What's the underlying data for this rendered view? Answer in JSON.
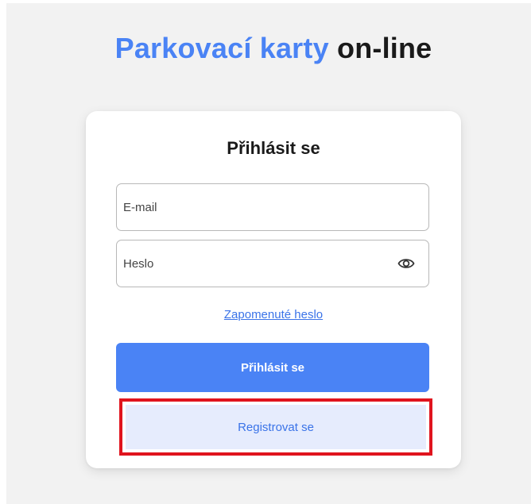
{
  "header": {
    "title_accent": "Parkovací karty",
    "title_rest": "on-line",
    "accent_color": "#4a83f5"
  },
  "login_form": {
    "title": "Přihlásit se",
    "email": {
      "placeholder": "E-mail",
      "value": ""
    },
    "password": {
      "placeholder": "Heslo",
      "value": "",
      "toggle_icon": "eye-icon"
    },
    "forgot_password_label": "Zapomenuté heslo",
    "submit_label": "Přihlásit se",
    "register_label": "Registrovat se",
    "highlight_color": "#e0141e"
  }
}
